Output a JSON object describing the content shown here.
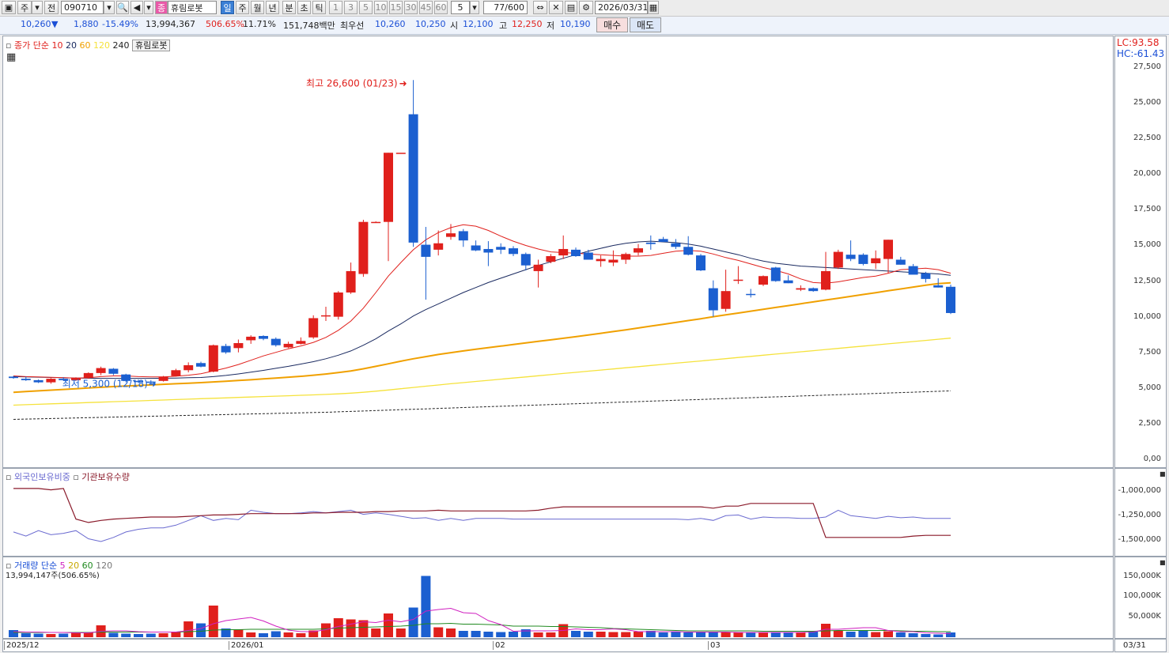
{
  "toolbar": {
    "market": "주",
    "scope": "전",
    "code": "090710",
    "badge": "종",
    "stock_name": "휴림로봇",
    "periods": [
      "일",
      "주",
      "월",
      "년",
      "분",
      "초",
      "틱"
    ],
    "minutes": [
      "1",
      "3",
      "5",
      "10",
      "15",
      "30",
      "45",
      "60"
    ],
    "count": "5",
    "position": "77/600",
    "date": "2026/03/31"
  },
  "quote": {
    "price": "10,260",
    "change": "1,880",
    "change_pct": "-15.49%",
    "volume": "13,994,367",
    "volume_ratio": "506.65%",
    "turnover": "11.71%",
    "amount": "151,748백만",
    "priority_label": "최우선",
    "bid": "10,260",
    "ask": "10,250",
    "open_label": "시",
    "open": "12,100",
    "high_label": "고",
    "high": "12,250",
    "low_label": "저",
    "low": "10,190",
    "buy_label": "매수",
    "sell_label": "매도"
  },
  "price_panel": {
    "legend_title": "종가 단순",
    "ma_periods": [
      "10",
      "20",
      "60",
      "120",
      "240"
    ],
    "ma_colors": [
      "#e0201c",
      "#1a2a60",
      "#f0a000",
      "#f5e23c",
      "#222222"
    ],
    "stock_tag": "휴림로봇",
    "lc": "LC:93.58",
    "hc": "HC:-61.43",
    "high_note": "최고 26,600 (01/23)",
    "low_note": "최저 5,300 (12/18)",
    "up_color": "#e0201c",
    "down_color": "#1b5fd0"
  },
  "holding_panel": {
    "legend_a": "외국인보유비중",
    "legend_b": "기관보유수량",
    "color_a": "#6a6ad0",
    "color_b": "#8a1a2a",
    "ticks": [
      "-1,000,000",
      "-1,250,000",
      "-1,500,000"
    ]
  },
  "volume_panel": {
    "legend_title": "거래량 단순",
    "ma_periods": [
      "5",
      "20",
      "60",
      "120"
    ],
    "summary": "13,994,147주(506.65%)",
    "ticks": [
      "150,000K",
      "100,000K",
      "50,000K"
    ]
  },
  "x_axis": {
    "labels": [
      "2025/12",
      "2026/01",
      "02",
      "03"
    ],
    "right_label": "03/31"
  },
  "chart_data": {
    "type": "candlestick",
    "ylim": [
      0,
      28000
    ],
    "y_ticks": [
      "27,500",
      "25,000",
      "22,500",
      "20,000",
      "17,500",
      "15,000",
      "12,500",
      "10,000",
      "7,500",
      "5,000",
      "2,500",
      "0,00"
    ],
    "candles": [
      [
        5800,
        5850,
        5650,
        5700
      ],
      [
        5650,
        5800,
        5500,
        5550
      ],
      [
        5550,
        5600,
        5350,
        5400
      ],
      [
        5400,
        5700,
        5300,
        5650
      ],
      [
        5650,
        5750,
        5500,
        5550
      ],
      [
        5550,
        5750,
        5500,
        5700
      ],
      [
        5700,
        6100,
        5650,
        6050
      ],
      [
        6050,
        6500,
        5900,
        6400
      ],
      [
        6350,
        6400,
        5900,
        6000
      ],
      [
        5950,
        6000,
        5400,
        5500
      ],
      [
        5500,
        5600,
        5350,
        5450
      ],
      [
        5450,
        5550,
        5300,
        5400
      ],
      [
        5500,
        5850,
        5450,
        5800
      ],
      [
        5850,
        6350,
        5800,
        6250
      ],
      [
        6250,
        6800,
        6100,
        6600
      ],
      [
        6750,
        6850,
        6450,
        6500
      ],
      [
        6150,
        8050,
        6100,
        8000
      ],
      [
        7950,
        8100,
        7400,
        7500
      ],
      [
        7800,
        8400,
        7500,
        8150
      ],
      [
        8350,
        8700,
        8100,
        8600
      ],
      [
        8650,
        8700,
        8350,
        8450
      ],
      [
        8450,
        8550,
        7900,
        8000
      ],
      [
        7850,
        8250,
        7800,
        8100
      ],
      [
        8100,
        8550,
        8050,
        8300
      ],
      [
        8550,
        10100,
        8450,
        9900
      ],
      [
        10050,
        10700,
        9700,
        10100
      ],
      [
        10000,
        11800,
        9800,
        11700
      ],
      [
        11700,
        13800,
        11600,
        13200
      ],
      [
        13000,
        16800,
        12800,
        16650
      ],
      [
        16650,
        16700,
        16650,
        16650
      ],
      [
        16650,
        21500,
        13900,
        21500
      ],
      [
        21500,
        21500,
        21500,
        21500
      ],
      [
        24200,
        26600,
        14900,
        15200
      ],
      [
        15050,
        16300,
        11200,
        14200
      ],
      [
        14700,
        16050,
        14300,
        15150
      ],
      [
        15600,
        16500,
        15400,
        15850
      ],
      [
        16000,
        16150,
        14900,
        15350
      ],
      [
        15000,
        15350,
        14600,
        14650
      ],
      [
        14750,
        15300,
        13550,
        14500
      ],
      [
        14900,
        15150,
        14400,
        14700
      ],
      [
        14800,
        14950,
        14250,
        14400
      ],
      [
        14400,
        14500,
        13250,
        13600
      ],
      [
        13200,
        14000,
        12050,
        13650
      ],
      [
        13850,
        14400,
        13750,
        14250
      ],
      [
        14300,
        15700,
        14050,
        14750
      ],
      [
        14700,
        14850,
        14200,
        14250
      ],
      [
        14500,
        14700,
        14000,
        14000
      ],
      [
        13900,
        14300,
        13500,
        14050
      ],
      [
        13800,
        14650,
        13550,
        14000
      ],
      [
        14000,
        14500,
        13700,
        14400
      ],
      [
        14500,
        15100,
        14300,
        14800
      ],
      [
        15200,
        15700,
        14700,
        15100
      ],
      [
        15450,
        15600,
        15250,
        15250
      ],
      [
        15150,
        15450,
        14750,
        14900
      ],
      [
        14900,
        15650,
        14300,
        14350
      ],
      [
        14300,
        14400,
        13200,
        13250
      ],
      [
        12000,
        12550,
        10000,
        10450
      ],
      [
        10550,
        13300,
        10350,
        11800
      ],
      [
        12550,
        13550,
        12300,
        12600
      ],
      [
        11600,
        11950,
        11350,
        11550
      ],
      [
        12250,
        12900,
        12150,
        12850
      ],
      [
        13450,
        13500,
        12450,
        12500
      ],
      [
        12550,
        12900,
        12350,
        12350
      ],
      [
        11900,
        12200,
        11800,
        12000
      ],
      [
        12000,
        12050,
        11750,
        11800
      ],
      [
        11900,
        14550,
        11850,
        13200
      ],
      [
        13450,
        14700,
        13350,
        14550
      ],
      [
        14350,
        15350,
        13900,
        14050
      ],
      [
        14350,
        14450,
        13600,
        13700
      ],
      [
        13750,
        14650,
        13350,
        14100
      ],
      [
        14050,
        15400,
        13050,
        15400
      ],
      [
        14000,
        14200,
        13650,
        13650
      ],
      [
        13550,
        13700,
        13550,
        12950
      ],
      [
        13050,
        13150,
        12400,
        12650
      ],
      [
        12200,
        12700,
        12050,
        12050
      ],
      [
        12100,
        12250,
        10190,
        10260
      ]
    ],
    "ma10": [
      5850,
      5800,
      5780,
      5750,
      5720,
      5700,
      5720,
      5800,
      5850,
      5850,
      5800,
      5780,
      5780,
      5830,
      5900,
      6000,
      6200,
      6400,
      6650,
      6950,
      7250,
      7500,
      7750,
      7950,
      8200,
      8550,
      9050,
      9700,
      10600,
      11700,
      12850,
      13800,
      14700,
      15400,
      15900,
      16250,
      16450,
      16350,
      16050,
      15650,
      15300,
      15000,
      14750,
      14550,
      14500,
      14450,
      14400,
      14350,
      14300,
      14250,
      14250,
      14300,
      14450,
      14600,
      14650,
      14600,
      14400,
      14150,
      13950,
      13700,
      13450,
      13250,
      13000,
      12650,
      12400,
      12350,
      12450,
      12600,
      12750,
      12850,
      13050,
      13300,
      13350,
      13400,
      13300,
      13050
    ],
    "ma20": [
      5800,
      5780,
      5760,
      5740,
      5720,
      5700,
      5690,
      5680,
      5680,
      5680,
      5680,
      5680,
      5690,
      5700,
      5720,
      5740,
      5800,
      5880,
      5990,
      6110,
      6240,
      6380,
      6520,
      6680,
      6850,
      7050,
      7300,
      7600,
      8000,
      8450,
      9000,
      9500,
      10050,
      10500,
      10900,
      11300,
      11700,
      12050,
      12400,
      12700,
      13000,
      13300,
      13600,
      13850,
      14100,
      14350,
      14600,
      14800,
      15000,
      15150,
      15250,
      15300,
      15250,
      15200,
      15100,
      14950,
      14750,
      14550,
      14350,
      14100,
      13900,
      13750,
      13650,
      13550,
      13500,
      13450,
      13400,
      13350,
      13300,
      13250,
      13200,
      13150,
      13100,
      13050,
      13000,
      12900
    ],
    "ma60": [
      4700,
      4750,
      4800,
      4850,
      4900,
      4950,
      5000,
      5050,
      5100,
      5140,
      5180,
      5220,
      5260,
      5300,
      5340,
      5380,
      5430,
      5480,
      5530,
      5580,
      5640,
      5700,
      5760,
      5820,
      5900,
      5980,
      6080,
      6200,
      6350,
      6520,
      6700,
      6880,
      7050,
      7200,
      7350,
      7480,
      7600,
      7720,
      7830,
      7940,
      8050,
      8160,
      8270,
      8380,
      8490,
      8600,
      8720,
      8840,
      8960,
      9080,
      9210,
      9340,
      9470,
      9600,
      9730,
      9860,
      10000,
      10130,
      10260,
      10390,
      10520,
      10650,
      10780,
      10910,
      11040,
      11170,
      11300,
      11430,
      11560,
      11690,
      11820,
      11950,
      12080,
      12210,
      12320,
      12380
    ],
    "ma120": [
      3800,
      3830,
      3860,
      3890,
      3920,
      3950,
      3980,
      4010,
      4040,
      4070,
      4100,
      4130,
      4160,
      4190,
      4220,
      4250,
      4280,
      4310,
      4340,
      4370,
      4400,
      4430,
      4460,
      4490,
      4520,
      4550,
      4590,
      4640,
      4700,
      4780,
      4860,
      4950,
      5040,
      5130,
      5210,
      5300,
      5380,
      5460,
      5540,
      5620,
      5700,
      5780,
      5860,
      5940,
      6020,
      6100,
      6180,
      6260,
      6340,
      6420,
      6500,
      6580,
      6660,
      6740,
      6820,
      6900,
      6980,
      7060,
      7140,
      7220,
      7300,
      7380,
      7460,
      7540,
      7620,
      7700,
      7780,
      7860,
      7940,
      8020,
      8100,
      8180,
      8260,
      8340,
      8420,
      8500
    ],
    "ma240": [
      2800,
      2820,
      2840,
      2860,
      2880,
      2900,
      2920,
      2940,
      2960,
      2980,
      3000,
      3020,
      3040,
      3060,
      3080,
      3100,
      3120,
      3140,
      3160,
      3180,
      3200,
      3220,
      3240,
      3260,
      3280,
      3300,
      3330,
      3360,
      3390,
      3420,
      3450,
      3480,
      3510,
      3540,
      3570,
      3600,
      3630,
      3660,
      3690,
      3720,
      3750,
      3780,
      3810,
      3840,
      3870,
      3900,
      3930,
      3960,
      3990,
      4020,
      4050,
      4080,
      4110,
      4140,
      4170,
      4200,
      4230,
      4260,
      4290,
      4320,
      4350,
      4380,
      4410,
      4440,
      4470,
      4500,
      4530,
      4560,
      4590,
      4620,
      4650,
      4680,
      4710,
      4740,
      4770,
      4800
    ],
    "volume": [
      18,
      10,
      9,
      8,
      9,
      12,
      12,
      30,
      11,
      9,
      8,
      9,
      10,
      13,
      40,
      35,
      80,
      22,
      20,
      12,
      10,
      15,
      12,
      10,
      17,
      35,
      48,
      45,
      43,
      22,
      60,
      22,
      75,
      155,
      25,
      22,
      16,
      16,
      14,
      13,
      14,
      20,
      12,
      12,
      33,
      16,
      14,
      14,
      13,
      13,
      14,
      16,
      12,
      13,
      12,
      13,
      14,
      12,
      13,
      12,
      11,
      11,
      11,
      12,
      14,
      34,
      17,
      14,
      16,
      13,
      15,
      12,
      10,
      8,
      7,
      12
    ],
    "vol_ma5": [
      14,
      13,
      13,
      12,
      12,
      11,
      11,
      15,
      16,
      16,
      14,
      13,
      13,
      13,
      17,
      22,
      34,
      42,
      46,
      50,
      41,
      28,
      18,
      14,
      14,
      19,
      27,
      33,
      39,
      37,
      43,
      39,
      45,
      66,
      70,
      73,
      62,
      60,
      42,
      32,
      15,
      16,
      16,
      16,
      17,
      21,
      19,
      19,
      21,
      19,
      14,
      14,
      14,
      14,
      13,
      13,
      13,
      13,
      12,
      12,
      12,
      12,
      12,
      12,
      13,
      20,
      20,
      22,
      24,
      24,
      17,
      14,
      14,
      11,
      10,
      9
    ],
    "vol_ma20": [
      12,
      12,
      12,
      12,
      12,
      12,
      12,
      13,
      13,
      13,
      13,
      13,
      13,
      13,
      14,
      15,
      18,
      19,
      19,
      20,
      20,
      20,
      20,
      20,
      20,
      21,
      23,
      24,
      25,
      26,
      27,
      28,
      30,
      34,
      34,
      35,
      33,
      33,
      32,
      31,
      28,
      28,
      28,
      27,
      27,
      26,
      25,
      24,
      22,
      21,
      20,
      19,
      18,
      17,
      16,
      16,
      16,
      16,
      16,
      16,
      15,
      15,
      15,
      15,
      15,
      16,
      17,
      17,
      17,
      17,
      17,
      16,
      15,
      15,
      14,
      14
    ],
    "foreign_ratio": [
      0.72,
      0.78,
      0.7,
      0.76,
      0.74,
      0.7,
      0.82,
      0.86,
      0.8,
      0.72,
      0.68,
      0.66,
      0.66,
      0.62,
      0.55,
      0.48,
      0.55,
      0.52,
      0.54,
      0.4,
      0.43,
      0.45,
      0.45,
      0.44,
      0.42,
      0.44,
      0.42,
      0.4,
      0.46,
      0.44,
      0.46,
      0.49,
      0.52,
      0.51,
      0.55,
      0.52,
      0.55,
      0.52,
      0.52,
      0.52,
      0.53,
      0.53,
      0.53,
      0.53,
      0.53,
      0.53,
      0.53,
      0.53,
      0.53,
      0.53,
      0.53,
      0.53,
      0.53,
      0.53,
      0.54,
      0.52,
      0.55,
      0.48,
      0.47,
      0.53,
      0.5,
      0.51,
      0.51,
      0.52,
      0.52,
      0.5,
      0.4,
      0.48,
      0.5,
      0.52,
      0.49,
      0.51,
      0.5,
      0.52,
      0.52,
      0.52
    ],
    "institution": [
      0.08,
      0.08,
      0.08,
      0.1,
      0.08,
      0.53,
      0.58,
      0.55,
      0.53,
      0.52,
      0.51,
      0.5,
      0.5,
      0.5,
      0.49,
      0.48,
      0.47,
      0.47,
      0.46,
      0.45,
      0.45,
      0.45,
      0.45,
      0.45,
      0.44,
      0.44,
      0.43,
      0.43,
      0.43,
      0.42,
      0.42,
      0.41,
      0.41,
      0.41,
      0.4,
      0.41,
      0.41,
      0.41,
      0.41,
      0.41,
      0.41,
      0.41,
      0.4,
      0.37,
      0.35,
      0.35,
      0.35,
      0.35,
      0.35,
      0.35,
      0.35,
      0.35,
      0.35,
      0.35,
      0.35,
      0.35,
      0.37,
      0.34,
      0.34,
      0.3,
      0.3,
      0.3,
      0.3,
      0.3,
      0.3,
      0.8,
      0.8,
      0.8,
      0.8,
      0.8,
      0.8,
      0.8,
      0.78,
      0.77,
      0.77,
      0.77
    ]
  }
}
